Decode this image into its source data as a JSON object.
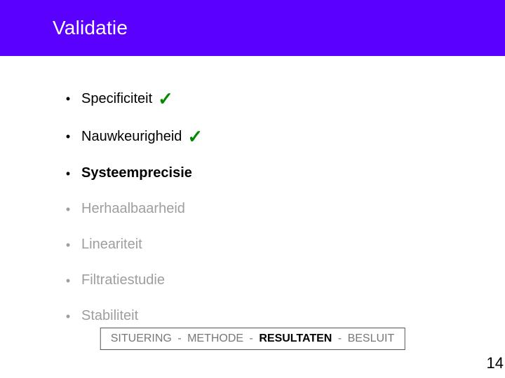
{
  "title": "Validatie",
  "items": [
    {
      "label": "Specificiteit",
      "checked": true,
      "bold": false,
      "greyed": false
    },
    {
      "label": "Nauwkeurigheid",
      "checked": true,
      "bold": false,
      "greyed": false
    },
    {
      "label": "Systeemprecisie",
      "checked": false,
      "bold": true,
      "greyed": false
    },
    {
      "label": "Herhaalbaarheid",
      "checked": false,
      "bold": false,
      "greyed": true
    },
    {
      "label": "Lineariteit",
      "checked": false,
      "bold": false,
      "greyed": true
    },
    {
      "label": "Filtratiestudie",
      "checked": false,
      "bold": false,
      "greyed": true
    },
    {
      "label": "Stabiliteit",
      "checked": false,
      "bold": false,
      "greyed": true
    }
  ],
  "breadcrumb": {
    "segments": [
      "SITUERING",
      "METHODE",
      "RESULTATEN",
      "BESLUIT"
    ],
    "active_index": 2,
    "separator": " - "
  },
  "page_number": "14",
  "checkmark_glyph": "✓",
  "bullet_glyph": "•"
}
